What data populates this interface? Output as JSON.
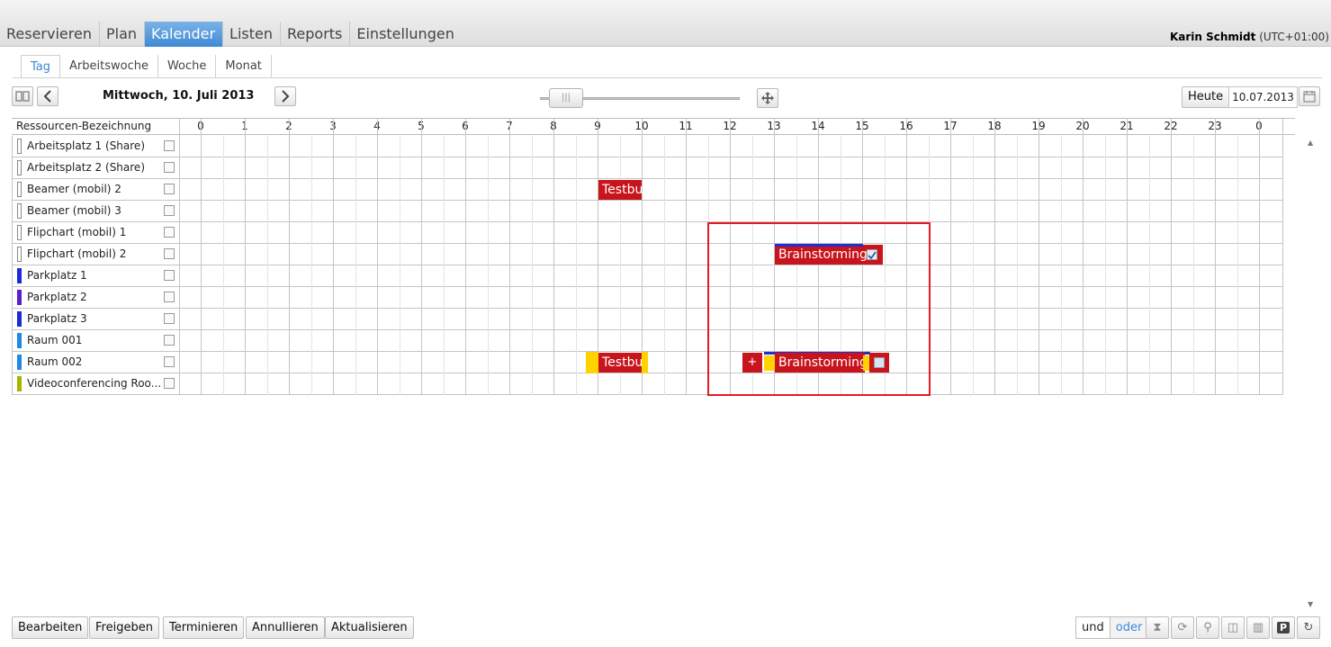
{
  "nav": {
    "items": [
      "Reservieren",
      "Plan",
      "Kalender",
      "Listen",
      "Reports",
      "Einstellungen"
    ],
    "active_index": 2,
    "user_name": "Karin Schmidt",
    "timezone": "(UTC+01:00)"
  },
  "subtabs": {
    "items": [
      "Tag",
      "Arbeitswoche",
      "Woche",
      "Monat"
    ],
    "active_index": 0
  },
  "toolbar": {
    "date_title": "Mittwoch, 10. Juli 2013",
    "today_label": "Heute",
    "date_value": "10.07.2013"
  },
  "grid": {
    "header_label": "Ressourcen-Bezeichnung",
    "hours": [
      "0",
      "1",
      "2",
      "3",
      "4",
      "5",
      "6",
      "7",
      "8",
      "9",
      "10",
      "11",
      "12",
      "13",
      "14",
      "15",
      "16",
      "17",
      "18",
      "19",
      "20",
      "21",
      "22",
      "23",
      "0"
    ],
    "resources": [
      {
        "name": "Arbeitsplatz 1 (Share)",
        "color": "#ffffff"
      },
      {
        "name": "Arbeitsplatz 2 (Share)",
        "color": "#ffffff"
      },
      {
        "name": "Beamer (mobil) 2",
        "color": "#ffffff"
      },
      {
        "name": "Beamer (mobil) 3",
        "color": "#ffffff"
      },
      {
        "name": "Flipchart (mobil) 1",
        "color": "#ffffff"
      },
      {
        "name": "Flipchart (mobil) 2",
        "color": "#ffffff"
      },
      {
        "name": "Parkplatz 1",
        "color": "#1d2bd6"
      },
      {
        "name": "Parkplatz 2",
        "color": "#5b1fd0"
      },
      {
        "name": "Parkplatz 3",
        "color": "#1d2bd6"
      },
      {
        "name": "Raum 001",
        "color": "#1e88e5"
      },
      {
        "name": "Raum 002",
        "color": "#1e88e5"
      },
      {
        "name": "Videoconferencing Roo...",
        "color": "#a8b400"
      }
    ],
    "bookings": [
      {
        "label": "Testbu",
        "resource_index": 2
      },
      {
        "label": "Brainstorming",
        "resource_index": 5
      },
      {
        "label": "Testbu",
        "resource_index": 10
      },
      {
        "label": "Brainstorming",
        "resource_index": 10
      }
    ],
    "add_glyph": "+"
  },
  "footer": {
    "buttons": [
      "Bearbeiten",
      "Freigeben",
      "Terminieren",
      "Annullieren",
      "Aktualisieren"
    ],
    "toggle_and": "und",
    "toggle_or": "oder",
    "icons": [
      "hourglass-icon",
      "sync-icon",
      "resource-icon",
      "split-view-icon",
      "print-icon",
      "parking-icon",
      "refresh-icon"
    ],
    "parking_label": "P"
  },
  "colors": {
    "accent": "#3f8ad6",
    "booking": "#c8141c",
    "highlight_box": "#e31b23",
    "yellow": "#ffd200"
  }
}
